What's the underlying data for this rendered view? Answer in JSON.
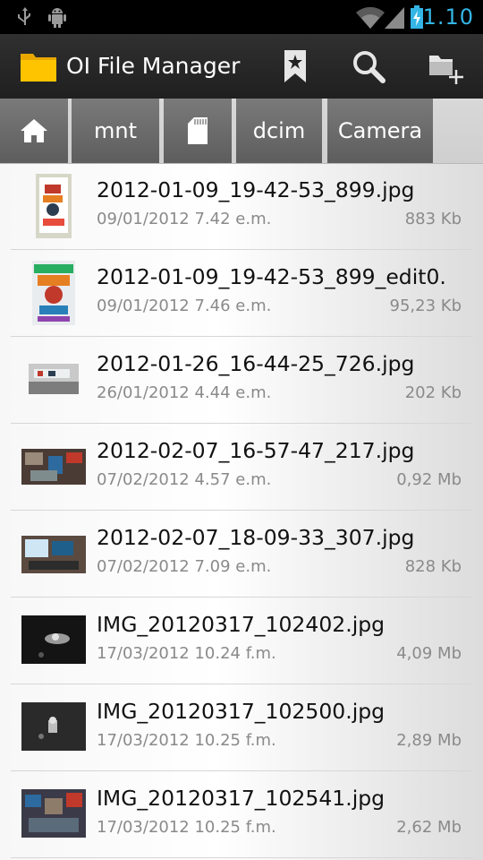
{
  "status_bar": {
    "time": "1.10",
    "accent": "#33b5e5"
  },
  "action_bar": {
    "title": "OI File Manager",
    "icons": [
      "folder-icon",
      "bookmark-icon",
      "search-icon",
      "new-folder-icon"
    ]
  },
  "path": {
    "home": "home-icon",
    "crumbs": [
      "mnt",
      "sdcard-icon",
      "dcim",
      "Camera"
    ],
    "mnt": "mnt",
    "dcim": "dcim",
    "camera": "Camera"
  },
  "files": [
    {
      "name": "2012-01-09_19-42-53_899.jpg",
      "date": "09/01/2012 7.42 e.m.",
      "size": "883 Kb"
    },
    {
      "name": "2012-01-09_19-42-53_899_edit0.",
      "date": "09/01/2012 7.46 e.m.",
      "size": "95,23 Kb"
    },
    {
      "name": "2012-01-26_16-44-25_726.jpg",
      "date": "26/01/2012 4.44 e.m.",
      "size": "202 Kb"
    },
    {
      "name": "2012-02-07_16-57-47_217.jpg",
      "date": "07/02/2012 4.57 e.m.",
      "size": "0,92 Mb"
    },
    {
      "name": "2012-02-07_18-09-33_307.jpg",
      "date": "07/02/2012 7.09 e.m.",
      "size": "828 Kb"
    },
    {
      "name": "IMG_20120317_102402.jpg",
      "date": "17/03/2012 10.24 f.m.",
      "size": "4,09 Mb"
    },
    {
      "name": "IMG_20120317_102500.jpg",
      "date": "17/03/2012 10.25 f.m.",
      "size": "2,89 Mb"
    },
    {
      "name": "IMG_20120317_102541.jpg",
      "date": "17/03/2012 10.25 f.m.",
      "size": "2,62 Mb"
    }
  ]
}
